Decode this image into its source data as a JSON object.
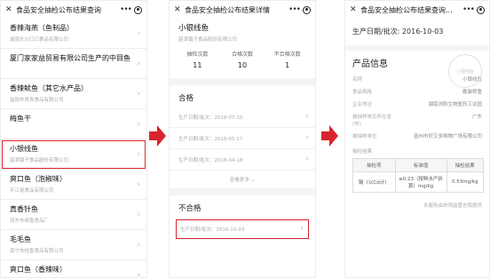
{
  "screen1": {
    "title": "食品安全抽检公布结果查询",
    "items": [
      {
        "name": "香辣海燕（鱼制品）",
        "company": "湖南长沙口口食品有限公司"
      },
      {
        "name": "厦门家家益贸易有限公司生产的中目鱼",
        "company": ""
      },
      {
        "name": "香辣鱿鱼（其它水产品）",
        "company": "益阳市青青食品有限公司"
      },
      {
        "name": "梅鱼干",
        "company": ""
      },
      {
        "name": "小银线鱼",
        "company": "韶津镇子食品股份有限公司",
        "highlight": true
      },
      {
        "name": "爽口鱼（泡椒味）",
        "company": "平江县食品有限公司"
      },
      {
        "name": "真香针鱼",
        "company": "祁东市鼎香食品厂"
      },
      {
        "name": "毛毛鱼",
        "company": "南宁市桂香食品有限公司"
      },
      {
        "name": "爽口鱼（香辣味）",
        "company": ""
      }
    ]
  },
  "screen2": {
    "title": "食品安全抽检公布结果详情",
    "product": "小银线鱼",
    "company": "韶津镇子食品股份有限公司",
    "stats": [
      {
        "label": "抽检次数",
        "value": "11"
      },
      {
        "label": "合格次数",
        "value": "10"
      },
      {
        "label": "不合格次数",
        "value": "1"
      }
    ],
    "qualified_title": "合格",
    "qualified_rows": [
      "生产日期/批次：2018-07-10",
      "生产日期/批次：2018-05-27",
      "生产日期/批次：2018-04-18"
    ],
    "load_more": "查看更多 ⌄",
    "unqualified_title": "不合格",
    "unqualified_rows": [
      "生产日期/批次：2016-10-03"
    ]
  },
  "screen3": {
    "title": "食品安全抽检公布结果查询...",
    "production_date": "生产日期/批次: 2016-10-03",
    "info_title": "产品信息",
    "stamp_text": "小银线鱼",
    "fields": [
      {
        "key": "名称",
        "value": "小银线鱼"
      },
      {
        "key": "食品规格",
        "value": "散装称重"
      },
      {
        "key": "企业地址",
        "value": "湖南浏阳生物医药工业园"
      },
      {
        "key": "被抽样单位所在省(市)",
        "value": "广东"
      },
      {
        "key": "被抽样单位",
        "value": "富州市好又多购物广场有限公司"
      }
    ],
    "result_title": "抽检结果",
    "table": {
      "headers": [
        "抽检项",
        "标准值",
        "抽检结果"
      ],
      "rows": [
        [
          "镉（以Cd计）",
          "≤0.23（按鲜水产折算）mg/kg",
          "0.53mg/kg"
        ]
      ]
    },
    "footnote": "本服务由市场监督总局提供"
  },
  "colors": {
    "highlight": "#d9242b",
    "arrow": "#d9242b"
  }
}
